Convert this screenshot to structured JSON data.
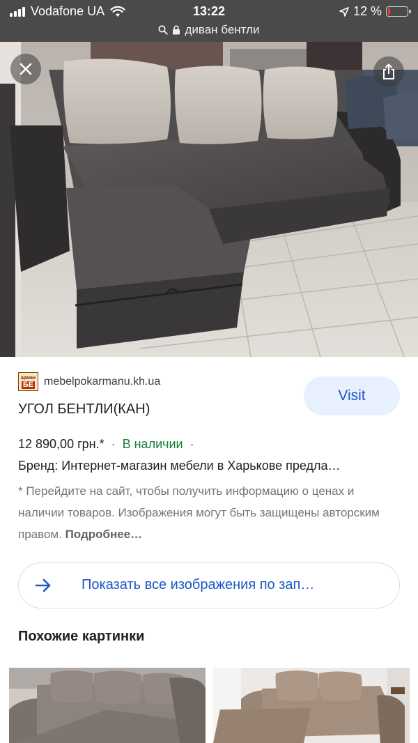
{
  "status_bar": {
    "carrier": "Vodafone UA",
    "time": "13:22",
    "battery_percent": "12 %",
    "battery_level": 0.12
  },
  "url_bar": {
    "query": "диван бентли"
  },
  "hero": {
    "icons": [
      "close-icon",
      "share-icon"
    ]
  },
  "result": {
    "favicon_top": "арман",
    "favicon_bottom": "БЕ",
    "domain": "mebelpokarmanu.kh.ua",
    "title": "УГОЛ БЕНТЛИ(КАН)",
    "visit_label": "Visit",
    "price": "12 890,00 грн.*",
    "separator": "·",
    "availability": "В наличии",
    "brand": "Бренд: Интернет-магазин мебели в Харькове предла…",
    "disclaimer": "* Перейдите на сайт, чтобы получить информацию о ценах и наличии товаров. Изображения могут быть защищены авторским правом.",
    "more_label": "Подробнее…"
  },
  "show_all": {
    "label": "Показать все изображения по зап…"
  },
  "similar": {
    "heading": "Похожие картинки"
  },
  "colors": {
    "status_bar_bg": "#4a4a4a",
    "link_blue": "#1a56c4",
    "visit_bg": "#e8f0fe",
    "in_stock_green": "#188038",
    "battery_red": "#ff3b30"
  }
}
